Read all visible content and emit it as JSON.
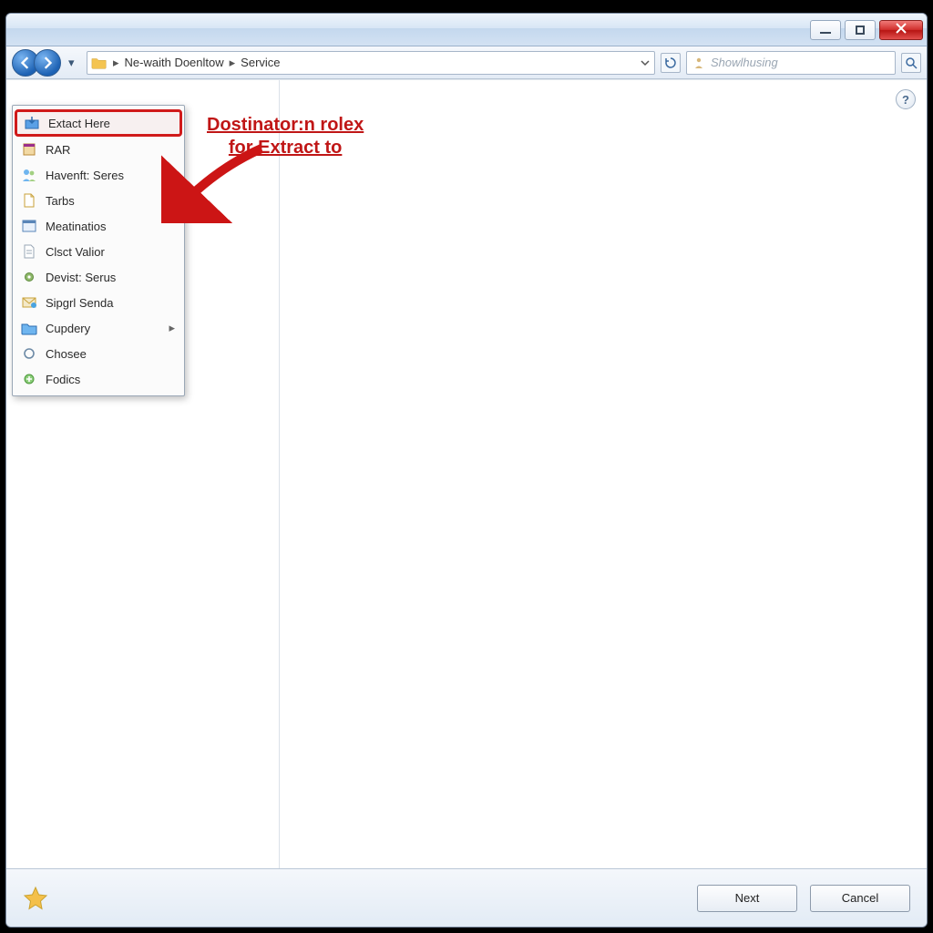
{
  "nav": {
    "breadcrumb": [
      "Ne-waith Doenltow",
      "Service"
    ]
  },
  "search": {
    "placeholder": "Showlhusing"
  },
  "context_menu": {
    "items": [
      {
        "label": "Extact Here",
        "icon": "extract-icon",
        "submenu": false,
        "highlight": true
      },
      {
        "label": "RAR",
        "icon": "rar-icon",
        "submenu": false
      },
      {
        "label": "Havenft: Seres",
        "icon": "users-icon",
        "submenu": false
      },
      {
        "label": "Tarbs",
        "icon": "page-icon",
        "submenu": false
      },
      {
        "label": "Meatinatios",
        "icon": "window-icon",
        "submenu": false
      },
      {
        "label": "Clsct Valior",
        "icon": "doc-icon",
        "submenu": false
      },
      {
        "label": "Devist: Serus",
        "icon": "gear-icon",
        "submenu": false
      },
      {
        "label": "Sipgrl Senda",
        "icon": "mail-icon",
        "submenu": false
      },
      {
        "label": "Cupdery",
        "icon": "folder-icon",
        "submenu": true
      },
      {
        "label": "Chosee",
        "icon": "circle-icon",
        "submenu": false
      },
      {
        "label": "Fodics",
        "icon": "plus-icon",
        "submenu": false
      }
    ]
  },
  "annotation": {
    "line1": "Dostinator:n rolex",
    "line2": "for Extract to"
  },
  "footer": {
    "next": "Next",
    "cancel": "Cancel"
  },
  "help": "?"
}
